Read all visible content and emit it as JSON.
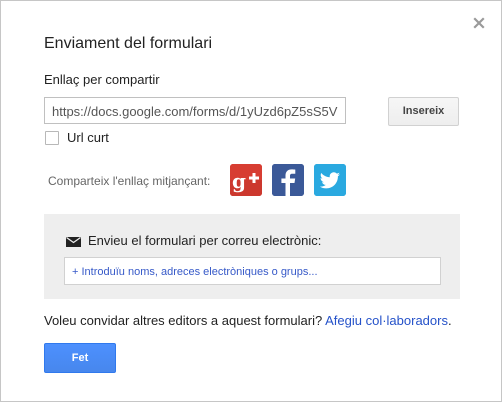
{
  "dialog": {
    "title": "Enviament del formulari",
    "close_icon": "close-icon"
  },
  "share_link": {
    "label": "Enllaç per compartir",
    "url_value": "https://docs.google.com/forms/d/1yUzd6pZ5sS5V",
    "insert_button": "Insereix",
    "short_url_label": "Url curt",
    "short_url_checked": false
  },
  "share_via": {
    "label": "Comparteix l'enllaç mitjançant:",
    "networks": [
      {
        "name": "google-plus",
        "icon": "google-plus-icon",
        "color": "#d73d32"
      },
      {
        "name": "facebook",
        "icon": "facebook-icon",
        "color": "#3b5998"
      },
      {
        "name": "twitter",
        "icon": "twitter-icon",
        "color": "#2aa9e0"
      }
    ]
  },
  "email": {
    "icon": "mail-icon",
    "label": "Envieu el formulari per correu electrònic:",
    "recipients_placeholder": "+ Introduïu noms, adreces electròniques o grups..."
  },
  "collaborators": {
    "question": "Voleu convidar altres editors a aquest formulari?",
    "link": "Afegiu col·laboradors",
    "suffix": "."
  },
  "footer": {
    "done_button": "Fet"
  },
  "colors": {
    "primary_button": "#4d90fe",
    "link": "#2552c9",
    "email_box_bg": "#eeeeee"
  }
}
